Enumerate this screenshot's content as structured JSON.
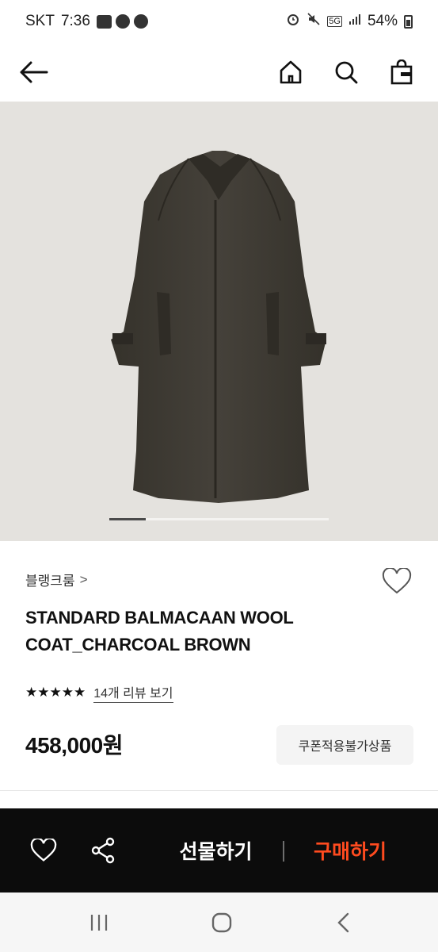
{
  "status_bar": {
    "carrier": "SKT",
    "time": "7:36",
    "network": "5G",
    "battery": "54%"
  },
  "nav": {
    "back": "back",
    "home": "home",
    "search": "search",
    "cart": "shopping-bag"
  },
  "carousel": {
    "current_index": 1,
    "position_fraction": 0.17
  },
  "product": {
    "brand": "블랭크룸",
    "brand_chevron": ">",
    "name_line1": "STANDARD BALMACAAN WOOL",
    "name_line2": "COAT_CHARCOAL BROWN",
    "stars": "★★★★★",
    "rating": 5,
    "review_link": "14개 리뷰 보기",
    "price": "458,000원",
    "coupon_badge": "쿠폰적용불가상품"
  },
  "action_bar": {
    "gift_label": "선물하기",
    "buy_label": "구매하기"
  },
  "colors": {
    "buy_accent": "#ff4b1f",
    "action_bar_bg": "#0c0c0c",
    "image_bg": "#e4e2de",
    "coat": "#3f3b32"
  }
}
